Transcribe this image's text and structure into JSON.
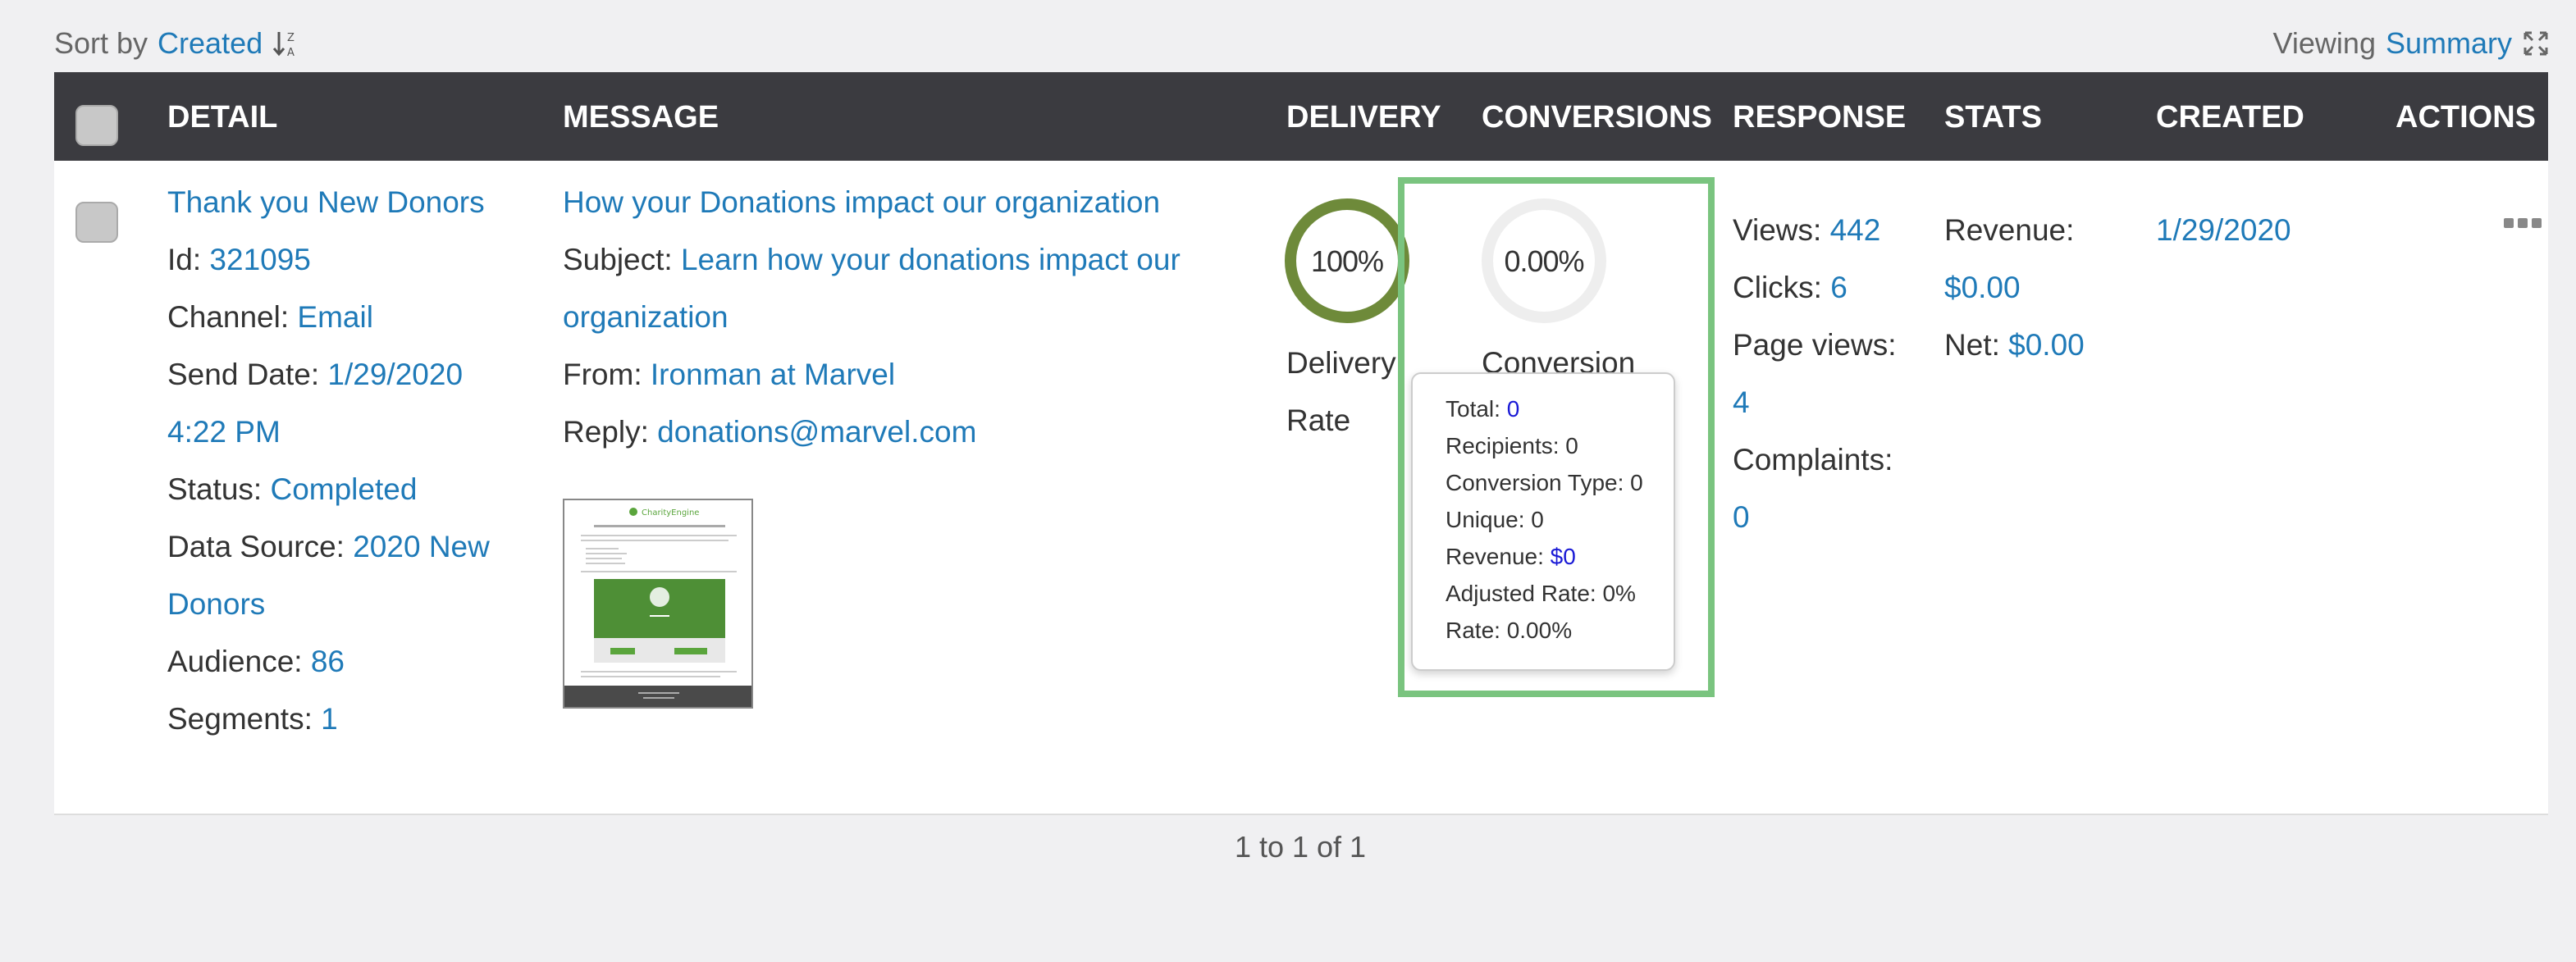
{
  "sort": {
    "label": "Sort by",
    "value": "Created"
  },
  "view": {
    "label": "Viewing",
    "value": "Summary"
  },
  "columns": {
    "detail": "DETAIL",
    "message": "MESSAGE",
    "delivery": "DELIVERY",
    "conversions": "CONVERSIONS",
    "response": "RESPONSE",
    "stats": "STATS",
    "created": "CREATED",
    "actions": "ACTIONS"
  },
  "row": {
    "detail": {
      "name": "Thank you New Donors",
      "id_label": "Id:",
      "id": "321095",
      "channel_label": "Channel:",
      "channel": "Email",
      "send_date_label": "Send Date:",
      "send_date_1": "1/29/2020",
      "send_date_2": "4:22 PM",
      "status_label": "Status:",
      "status": "Completed",
      "data_source_label": "Data Source:",
      "data_source_1": "2020 New",
      "data_source_2": "Donors",
      "audience_label": "Audience:",
      "audience": "86",
      "segments_label": "Segments:",
      "segments": "1"
    },
    "message": {
      "title": "How your Donations impact our organization",
      "subject_label": "Subject:",
      "subject_1": "Learn how your donations impact our",
      "subject_2": "organization",
      "from_label": "From:",
      "from": "Ironman at Marvel",
      "reply_label": "Reply:",
      "reply": "donations@marvel.com",
      "thumbnail_brand": "CharityEngine"
    },
    "delivery": {
      "rate_value": "100%",
      "rate_fraction": 1.0,
      "label_1": "Delivery",
      "label_2": "Rate",
      "color": "#6e8a3a"
    },
    "conversions": {
      "rate_value": "0.00%",
      "rate_fraction": 0.0,
      "label": "Conversion",
      "tooltip": {
        "total_label": "Total:",
        "total": "0",
        "recipients": "Recipients: 0",
        "conversion_type": "Conversion Type: 0",
        "unique": "Unique: 0",
        "revenue_label": "Revenue:",
        "revenue": "$0",
        "adjusted_rate": "Adjusted Rate: 0%",
        "rate": "Rate: 0.00%"
      }
    },
    "response": {
      "views_label": "Views:",
      "views": "442",
      "clicks_label": "Clicks:",
      "clicks": "6",
      "page_views_label": "Page views:",
      "page_views": "4",
      "complaints_label": "Complaints:",
      "complaints": "0"
    },
    "stats": {
      "revenue_label": "Revenue:",
      "revenue": "$0.00",
      "net_label": "Net:",
      "net": "$0.00"
    },
    "created": "1/29/2020"
  },
  "pager": "1 to 1 of 1",
  "colors": {
    "header_bg": "#3b3b40",
    "link": "#1f7ab8",
    "highlight": "#7ac47f",
    "donut_track": "#eeeeee"
  }
}
